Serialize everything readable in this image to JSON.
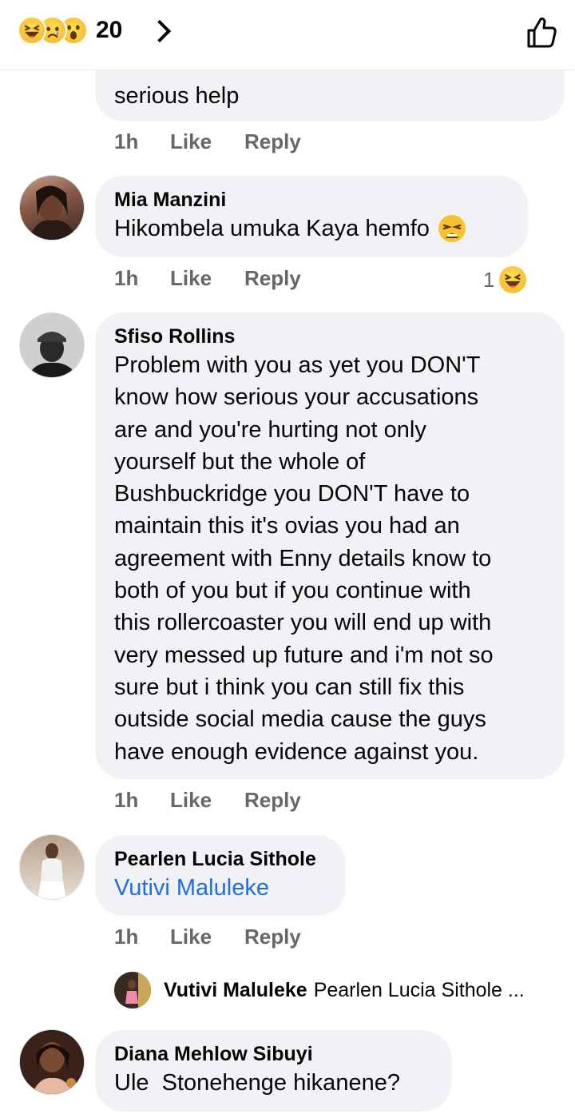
{
  "header": {
    "reaction_count": "20",
    "reaction_icons": [
      "haha-emoji",
      "sad-emoji",
      "wow-emoji"
    ],
    "like_icon": "thumbs-up-outline-icon"
  },
  "comments": [
    {
      "partial_text": "serious help",
      "meta": {
        "time": "1h",
        "like": "Like",
        "reply": "Reply"
      }
    },
    {
      "author": "Mia Manzini",
      "text": "Hikombela umuka Kaya hemfo",
      "emoji": "tired-face-emoji",
      "meta": {
        "time": "1h",
        "like": "Like",
        "reply": "Reply"
      },
      "reaction_count": "1",
      "reaction_icon": "haha-emoji"
    },
    {
      "author": "Sfiso Rollins",
      "text": "Problem with you as yet you DON'T\nknow how serious your accusations\nare and you're hurting not only\nyourself but the whole of\nBushbuckridge you DON'T have to\nmaintain this it's ovias you had an\nagreement with Enny details know to\nboth of you but if you continue with\nthis rollercoaster you will end up with\nvery messed up future and i'm not so\nsure but i think you can still fix this\noutside social media cause the guys\nhave enough evidence against you.",
      "meta": {
        "time": "1h",
        "like": "Like",
        "reply": "Reply"
      }
    },
    {
      "author": "Pearlen Lucia Sithole",
      "mention": "Vutivi Maluleke",
      "meta": {
        "time": "1h",
        "like": "Like",
        "reply": "Reply"
      }
    },
    {
      "author": "Diana Mehlow Sibuyi",
      "text": "Ule  Stonehenge hikanene?"
    }
  ],
  "reply_preview": {
    "name": "Vutivi Maluleke",
    "text": "Pearlen Lucia Sithole ..."
  },
  "colors": {
    "bubble": "#f0f2f5",
    "meta_text": "#65676b",
    "mention": "#216fdb",
    "reaction_yellow": "#f7b125"
  }
}
